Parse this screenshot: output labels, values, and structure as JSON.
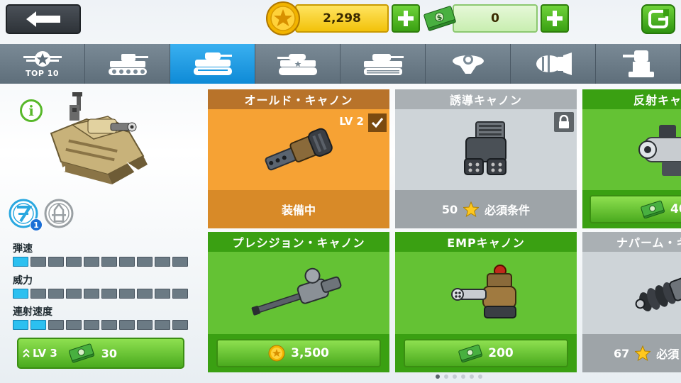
{
  "currency": {
    "coins": "2,298",
    "cash": "0"
  },
  "tabs": [
    {
      "label": "TOP 10",
      "icon": "star-emblem-icon"
    },
    {
      "label": "",
      "icon": "tank-icon"
    },
    {
      "label": "",
      "icon": "light-tank-icon"
    },
    {
      "label": "",
      "icon": "medium-tank-icon"
    },
    {
      "label": "",
      "icon": "heavy-tank-icon"
    },
    {
      "label": "",
      "icon": "hover-tank-icon"
    },
    {
      "label": "",
      "icon": "bomb-icon"
    },
    {
      "label": "",
      "icon": "turret-icon"
    }
  ],
  "active_tab": 2,
  "stats": [
    {
      "label": "弾速",
      "level": 1,
      "max": 10
    },
    {
      "label": "威力",
      "level": 1,
      "max": 10
    },
    {
      "label": "連射速度",
      "level": 2,
      "max": 10
    }
  ],
  "ammo_badge_count": "1",
  "upgrade": {
    "level": "LV 3",
    "cost": "30"
  },
  "cards": [
    {
      "title": "オールド・キャノン",
      "level": "LV 2",
      "footer": "装備中",
      "state": "equipped"
    },
    {
      "title": "誘導キャノン",
      "footer_count": "50",
      "footer_text": "必須条件",
      "state": "locked"
    },
    {
      "title": "反射キャ",
      "price": "40",
      "state": "buy-cash"
    },
    {
      "title": "プレシジョン・キャノン",
      "price": "3,500",
      "state": "buy-coin"
    },
    {
      "title": "EMPキャノン",
      "price": "200",
      "state": "buy-cash"
    },
    {
      "title": "ナパーム・キ",
      "footer_count": "67",
      "footer_text": "必須",
      "state": "locked"
    }
  ],
  "colors": {
    "equipped_title": "#b8732a",
    "equipped_body": "#f6a234",
    "equipped_foot": "#d88a28",
    "locked_title": "#aab0b4",
    "locked_body": "#ced4d8",
    "locked_foot": "#9ea4a8",
    "shop_title": "#3aa012",
    "shop_body": "#64c234",
    "shop_foot": "#3aa012",
    "tab_active": "#1aa0e8"
  },
  "pager": {
    "count": 6,
    "active": 0
  }
}
